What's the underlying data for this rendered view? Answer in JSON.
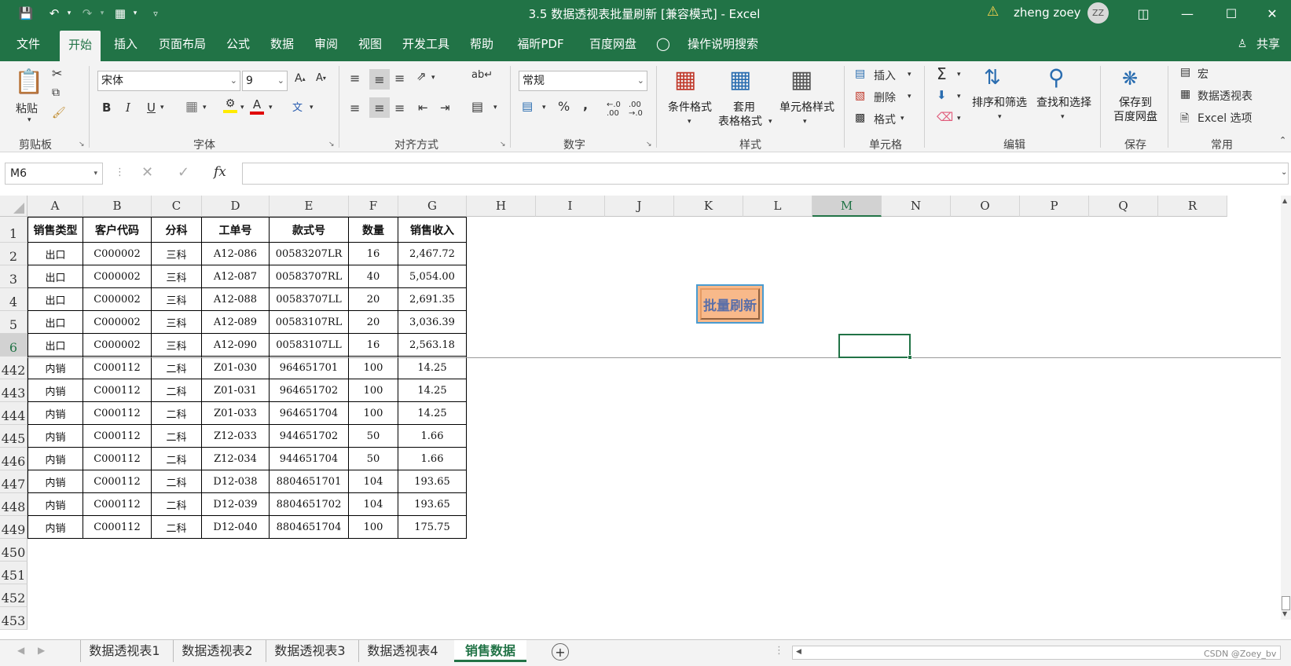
{
  "titlebar": {
    "title": "3.5 数据透视表批量刷新  [兼容模式]  -  Excel",
    "user": "zheng zoey",
    "initials": "ZZ"
  },
  "tabs": [
    "文件",
    "开始",
    "插入",
    "页面布局",
    "公式",
    "数据",
    "审阅",
    "视图",
    "开发工具",
    "帮助",
    "福昕PDF",
    "百度网盘",
    "操作说明搜索"
  ],
  "share": "共享",
  "ribbon": {
    "clipboard": {
      "paste": "粘贴",
      "label": "剪贴板"
    },
    "font": {
      "name": "宋体",
      "size": "9",
      "label": "字体"
    },
    "alignment": {
      "label": "对齐方式"
    },
    "number": {
      "format": "常规",
      "label": "数字"
    },
    "styles": {
      "cond": "条件格式",
      "table1": "套用",
      "table2": "表格格式",
      "cell": "单元格样式",
      "label": "样式"
    },
    "cells": {
      "insert": "插入",
      "delete": "删除",
      "format": "格式",
      "label": "单元格"
    },
    "editing": {
      "sort": "排序和筛选",
      "find": "查找和选择",
      "label": "编辑"
    },
    "save": {
      "l1": "保存到",
      "l2": "百度网盘",
      "label": "保存"
    },
    "common": {
      "macro": "宏",
      "pivot": "数据透视表",
      "options": "Excel 选项",
      "label": "常用"
    }
  },
  "namebox": "M6",
  "columns": [
    "A",
    "B",
    "C",
    "D",
    "E",
    "F",
    "G",
    "H",
    "I",
    "J",
    "K",
    "L",
    "M",
    "N",
    "O",
    "P",
    "Q",
    "R"
  ],
  "header_row": [
    "销售类型",
    "客户代码",
    "分科",
    "工单号",
    "款式号",
    "数量",
    "销售收入"
  ],
  "rows": [
    {
      "n": "1"
    },
    {
      "n": "2",
      "c": [
        "出口",
        "C000002",
        "三科",
        "A12-086",
        "00583207LR",
        "16",
        "2,467.72"
      ]
    },
    {
      "n": "3",
      "c": [
        "出口",
        "C000002",
        "三科",
        "A12-087",
        "00583707RL",
        "40",
        "5,054.00"
      ]
    },
    {
      "n": "4",
      "c": [
        "出口",
        "C000002",
        "三科",
        "A12-088",
        "00583707LL",
        "20",
        "2,691.35"
      ]
    },
    {
      "n": "5",
      "c": [
        "出口",
        "C000002",
        "三科",
        "A12-089",
        "00583107RL",
        "20",
        "3,036.39"
      ]
    },
    {
      "n": "6",
      "c": [
        "出口",
        "C000002",
        "三科",
        "A12-090",
        "00583107LL",
        "16",
        "2,563.18"
      ]
    },
    {
      "n": "442",
      "c": [
        "内销",
        "C000112",
        "二科",
        "Z01-030",
        "964651701",
        "100",
        "14.25"
      ]
    },
    {
      "n": "443",
      "c": [
        "内销",
        "C000112",
        "二科",
        "Z01-031",
        "964651702",
        "100",
        "14.25"
      ]
    },
    {
      "n": "444",
      "c": [
        "内销",
        "C000112",
        "二科",
        "Z01-033",
        "964651704",
        "100",
        "14.25"
      ]
    },
    {
      "n": "445",
      "c": [
        "内销",
        "C000112",
        "二科",
        "Z12-033",
        "944651702",
        "50",
        "1.66"
      ]
    },
    {
      "n": "446",
      "c": [
        "内销",
        "C000112",
        "二科",
        "Z12-034",
        "944651704",
        "50",
        "1.66"
      ]
    },
    {
      "n": "447",
      "c": [
        "内销",
        "C000112",
        "二科",
        "D12-038",
        "8804651701",
        "104",
        "193.65"
      ]
    },
    {
      "n": "448",
      "c": [
        "内销",
        "C000112",
        "二科",
        "D12-039",
        "8804651702",
        "104",
        "193.65"
      ]
    },
    {
      "n": "449",
      "c": [
        "内销",
        "C000112",
        "二科",
        "D12-040",
        "8804651704",
        "100",
        "175.75"
      ]
    },
    {
      "n": "450"
    },
    {
      "n": "451"
    },
    {
      "n": "452"
    },
    {
      "n": "453"
    }
  ],
  "button": {
    "label": "批量刷新"
  },
  "sheets": [
    "数据透视表1",
    "数据透视表2",
    "数据透视表3",
    "数据透视表4",
    "销售数据"
  ],
  "watermark": "CSDN @Zoey_bv",
  "colors": {
    "excel_green": "#217346",
    "button_fill": "#f8b98a",
    "button_text": "#5b6fa8"
  }
}
